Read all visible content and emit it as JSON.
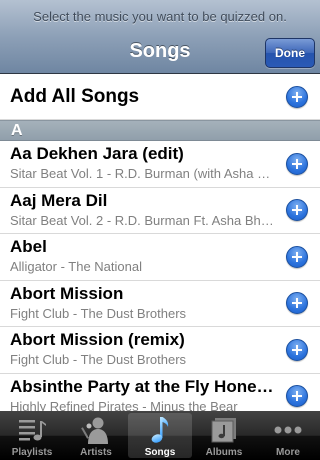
{
  "navbar": {
    "prompt": "Select the music you want to be quizzed on.",
    "title": "Songs",
    "done_label": "Done"
  },
  "list": {
    "add_all_label": "Add All Songs",
    "section_letter": "A",
    "songs": [
      {
        "title": "Aa Dekhen Jara (edit)",
        "subtitle": "Sitar Beat Vol. 1 - R.D. Burman (with Asha Bhosle)"
      },
      {
        "title": "Aaj Mera Dil",
        "subtitle": "Sitar Beat Vol. 2 - R.D. Burman Ft. Asha Bhosle"
      },
      {
        "title": "Abel",
        "subtitle": "Alligator - The National"
      },
      {
        "title": "Abort Mission",
        "subtitle": "Fight Club - The Dust Brothers"
      },
      {
        "title": "Abort Mission (remix)",
        "subtitle": "Fight Club - The Dust Brothers"
      },
      {
        "title": "Absinthe Party at the Fly Honey Warehouse",
        "subtitle": "Highly Refined Pirates - Minus the Bear"
      }
    ]
  },
  "tabbar": {
    "tabs": [
      {
        "label": "Playlists",
        "icon": "playlists-icon"
      },
      {
        "label": "Artists",
        "icon": "artists-icon"
      },
      {
        "label": "Songs",
        "icon": "songs-icon",
        "selected": true
      },
      {
        "label": "Albums",
        "icon": "albums-icon"
      },
      {
        "label": "More",
        "icon": "more-icon"
      }
    ]
  },
  "colors": {
    "accent_blue": "#2c73dd",
    "selected_tab_icon": "#5bb8ff"
  }
}
